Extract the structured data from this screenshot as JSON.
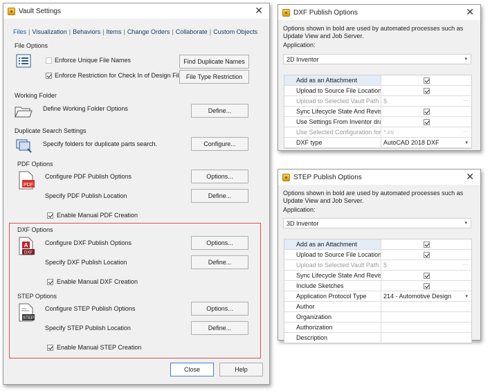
{
  "vault": {
    "title": "Vault Settings",
    "tabs": [
      {
        "label": "Files"
      },
      {
        "label": "Visualization"
      },
      {
        "label": "Behaviors"
      },
      {
        "label": "Items"
      },
      {
        "label": "Change Orders"
      },
      {
        "label": "Collaborate"
      },
      {
        "label": "Custom Objects"
      }
    ],
    "file_options": {
      "label": "File Options",
      "unique_names": "Enforce Unique File Names",
      "restriction": "Enforce Restriction for Check In of Design Files",
      "find_duplicates_btn": "Find Duplicate Names",
      "file_type_btn": "File Type Restriction"
    },
    "working_folder": {
      "label": "Working Folder",
      "text": "Define Working Folder Options",
      "btn": "Define..."
    },
    "duplicate_search": {
      "label": "Duplicate Search Settings",
      "text": "Specify folders for duplicate parts search.",
      "btn": "Configure..."
    },
    "pdf": {
      "label": "PDF Options",
      "configure": "Configure PDF Publish Options",
      "options_btn": "Options...",
      "location": "Specify PDF Publish Location",
      "define_btn": "Define...",
      "manual": "Enable Manual PDF Creation",
      "icon_text": "PDF"
    },
    "dxf": {
      "label": "DXF Options",
      "configure": "Configure DXF Publish Options",
      "options_btn": "Options...",
      "location": "Specify DXF Publish Location",
      "define_btn": "Define...",
      "manual": "Enable Manual DXF Creation",
      "icon_text": "DXF",
      "icon_letter": "A"
    },
    "step": {
      "label": "STEP Options",
      "configure": "Configure STEP Publish Options",
      "options_btn": "Options...",
      "location": "Specify STEP Publish Location",
      "define_btn": "Define...",
      "manual": "Enable Manual STEP Creation",
      "icon_text": "STEP"
    },
    "close_btn": "Close",
    "help_btn": "Help"
  },
  "dxf_dialog": {
    "title": "DXF Publish Options",
    "note": "Options shown in bold are used by automated processes such as Update View and Job Server.",
    "application_label": "Application:",
    "application_value": "2D Inventor",
    "rows": [
      {
        "label": "Add as an Attachment",
        "value": ""
      },
      {
        "label": "Upload to Source File Location",
        "value": ""
      },
      {
        "label": "Upload to Selected Vault Path",
        "value": "$"
      },
      {
        "label": "Sync Lifecycle State And Revisi...",
        "value": ""
      },
      {
        "label": "Use Settings From Inventor dra...",
        "value": ""
      },
      {
        "label": "Use Selected Configuration for ...",
        "value": "*.ini"
      },
      {
        "label": "DXF type",
        "value": "AutoCAD 2018 DXF"
      }
    ]
  },
  "step_dialog": {
    "title": "STEP Publish Options",
    "note": "Options shown in bold are used by automated processes such as Update View and Job Server.",
    "application_label": "Application:",
    "application_value": "3D Inventor",
    "rows": [
      {
        "label": "Add as an Attachment",
        "value": ""
      },
      {
        "label": "Upload to Source File Location",
        "value": ""
      },
      {
        "label": "Upload to Selected Vault Path",
        "value": "$"
      },
      {
        "label": "Sync Lifecycle State And Revisi...",
        "value": ""
      },
      {
        "label": "Include Sketches",
        "value": ""
      },
      {
        "label": "Application Protocol Type",
        "value": "214 - Automotive Design"
      },
      {
        "label": "Author",
        "value": ""
      },
      {
        "label": "Organization",
        "value": ""
      },
      {
        "label": "Authorization",
        "value": ""
      },
      {
        "label": "Description",
        "value": ""
      }
    ]
  },
  "colors": {
    "accent": "#0b5fc0",
    "highlight_frame": "#d9534f",
    "selected_row": "#e3ecf7"
  }
}
